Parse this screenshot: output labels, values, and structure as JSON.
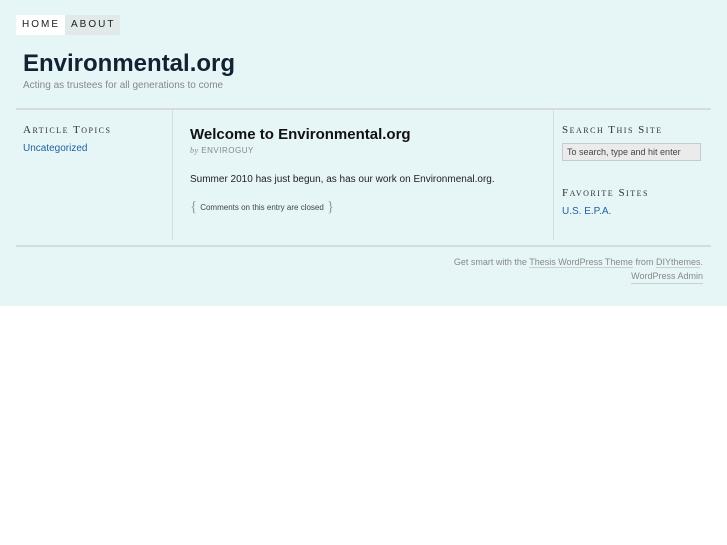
{
  "nav": {
    "items": [
      "HOME",
      "ABOUT"
    ]
  },
  "header": {
    "title": "Environmental.org",
    "tagline": "Acting as trustees for all generations to come"
  },
  "sidebar_left": {
    "heading": "Article Topics",
    "links": [
      "Uncategorized"
    ]
  },
  "post": {
    "title": "Welcome to Environmental.org",
    "by": "by",
    "author": "ENVIROGUY",
    "body": "Summer 2010 has just begun, as has our work on Environmenal.org.",
    "comments_note": "Comments on this entry are closed",
    "brace_open": "{",
    "brace_close": "}"
  },
  "sidebar_right": {
    "search_heading": "Search This Site",
    "search_value": "To search, type and hit enter",
    "favorites_heading": "Favorite Sites",
    "favorite_links": [
      "U.S. E.P.A."
    ]
  },
  "footer": {
    "prefix": "Get smart with the",
    "theme_link": "Thesis WordPress Theme",
    "middle": "from",
    "diy_link": "DIYthemes",
    "suffix": ".",
    "admin_link": "WordPress Admin"
  },
  "colors": {
    "background": "#e6f6f6",
    "link": "#2361a1"
  }
}
